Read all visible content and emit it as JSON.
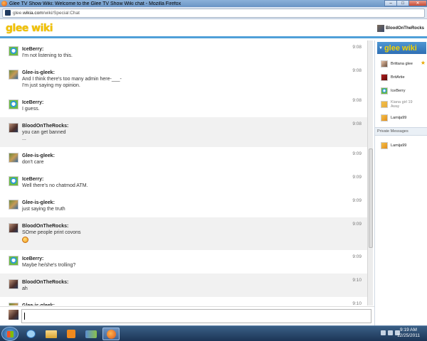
{
  "window": {
    "title": "Glee TV Show Wiki: Welcome to the Glee TV Show Wiki chat - Mozilla Firefox",
    "minimize": "–",
    "maximize": "□",
    "close": "✕"
  },
  "addressbar": {
    "url_prefix": "glee.",
    "url_domain": "wikia.com",
    "url_path": "/wiki/Special:Chat"
  },
  "header": {
    "logo": "glee wiki",
    "username": "BloodOnTheRocks"
  },
  "messages": [
    {
      "user": "IceBerry:",
      "lines": [
        "I'm not listening to this."
      ],
      "time": "9:08",
      "avatar": "iceberry-avatar",
      "alt": false
    },
    {
      "user": "Glee-is-gleek:",
      "lines": [
        "And I think there's too many admin here-___-",
        "I'm just saying my opinion."
      ],
      "time": "9:08",
      "avatar": "gleek-avatar",
      "alt": false
    },
    {
      "user": "IceBerry:",
      "lines": [
        "I guess."
      ],
      "time": "9:08",
      "avatar": "iceberry-avatar",
      "alt": false
    },
    {
      "user": "BloodOnTheRocks:",
      "lines": [
        "you can get banned",
        "..."
      ],
      "time": "9:08",
      "avatar": "blood-avatar",
      "alt": true
    },
    {
      "user": "Glee-is-gleek:",
      "lines": [
        "don't care"
      ],
      "time": "9:09",
      "avatar": "gleek-avatar",
      "alt": false
    },
    {
      "user": "IceBerry:",
      "lines": [
        "Well there's no chatmod ATM."
      ],
      "time": "9:09",
      "avatar": "iceberry-avatar",
      "alt": false
    },
    {
      "user": "Glee-is-gleek:",
      "lines": [
        "just saying the truth"
      ],
      "time": "9:09",
      "avatar": "gleek-avatar",
      "alt": false
    },
    {
      "user": "BloodOnTheRocks:",
      "lines": [
        "SOme people print covons"
      ],
      "time": "9:09",
      "avatar": "blood-avatar",
      "alt": true,
      "emoticon": "smiley-icon"
    },
    {
      "user": "IceBerry:",
      "lines": [
        "Maybe he/she's trolling?"
      ],
      "time": "9:09",
      "avatar": "iceberry-avatar",
      "alt": false
    },
    {
      "user": "BloodOnTheRocks:",
      "lines": [
        "ah"
      ],
      "time": "9:10",
      "avatar": "blood-avatar",
      "alt": true
    },
    {
      "user": "Glee-is-gleek:",
      "lines": [
        ""
      ],
      "time": "9:10",
      "avatar": "gleek-avatar",
      "alt": false
    }
  ],
  "sidebar": {
    "logo": "glee wiki",
    "users": [
      {
        "name": "Brittana glee",
        "avatar": "brittana",
        "star": true
      },
      {
        "name": "BritArtie",
        "avatar": "britartie"
      },
      {
        "name": "IceBerry",
        "avatar": "ice"
      },
      {
        "name": "Kiana girl 19",
        "status": "Away",
        "avatar": "kiana",
        "away": true
      },
      {
        "name": "Lamija99",
        "avatar": "lamija"
      }
    ],
    "private_header": "Private Messages",
    "private_users": [
      {
        "name": "Lamija99",
        "avatar": "lamija"
      }
    ]
  },
  "taskbar": {
    "time": "9:19 AM",
    "date": "12/25/2011"
  },
  "colors": {
    "accent": "#4fa0d8",
    "logo": "#f2c100"
  }
}
